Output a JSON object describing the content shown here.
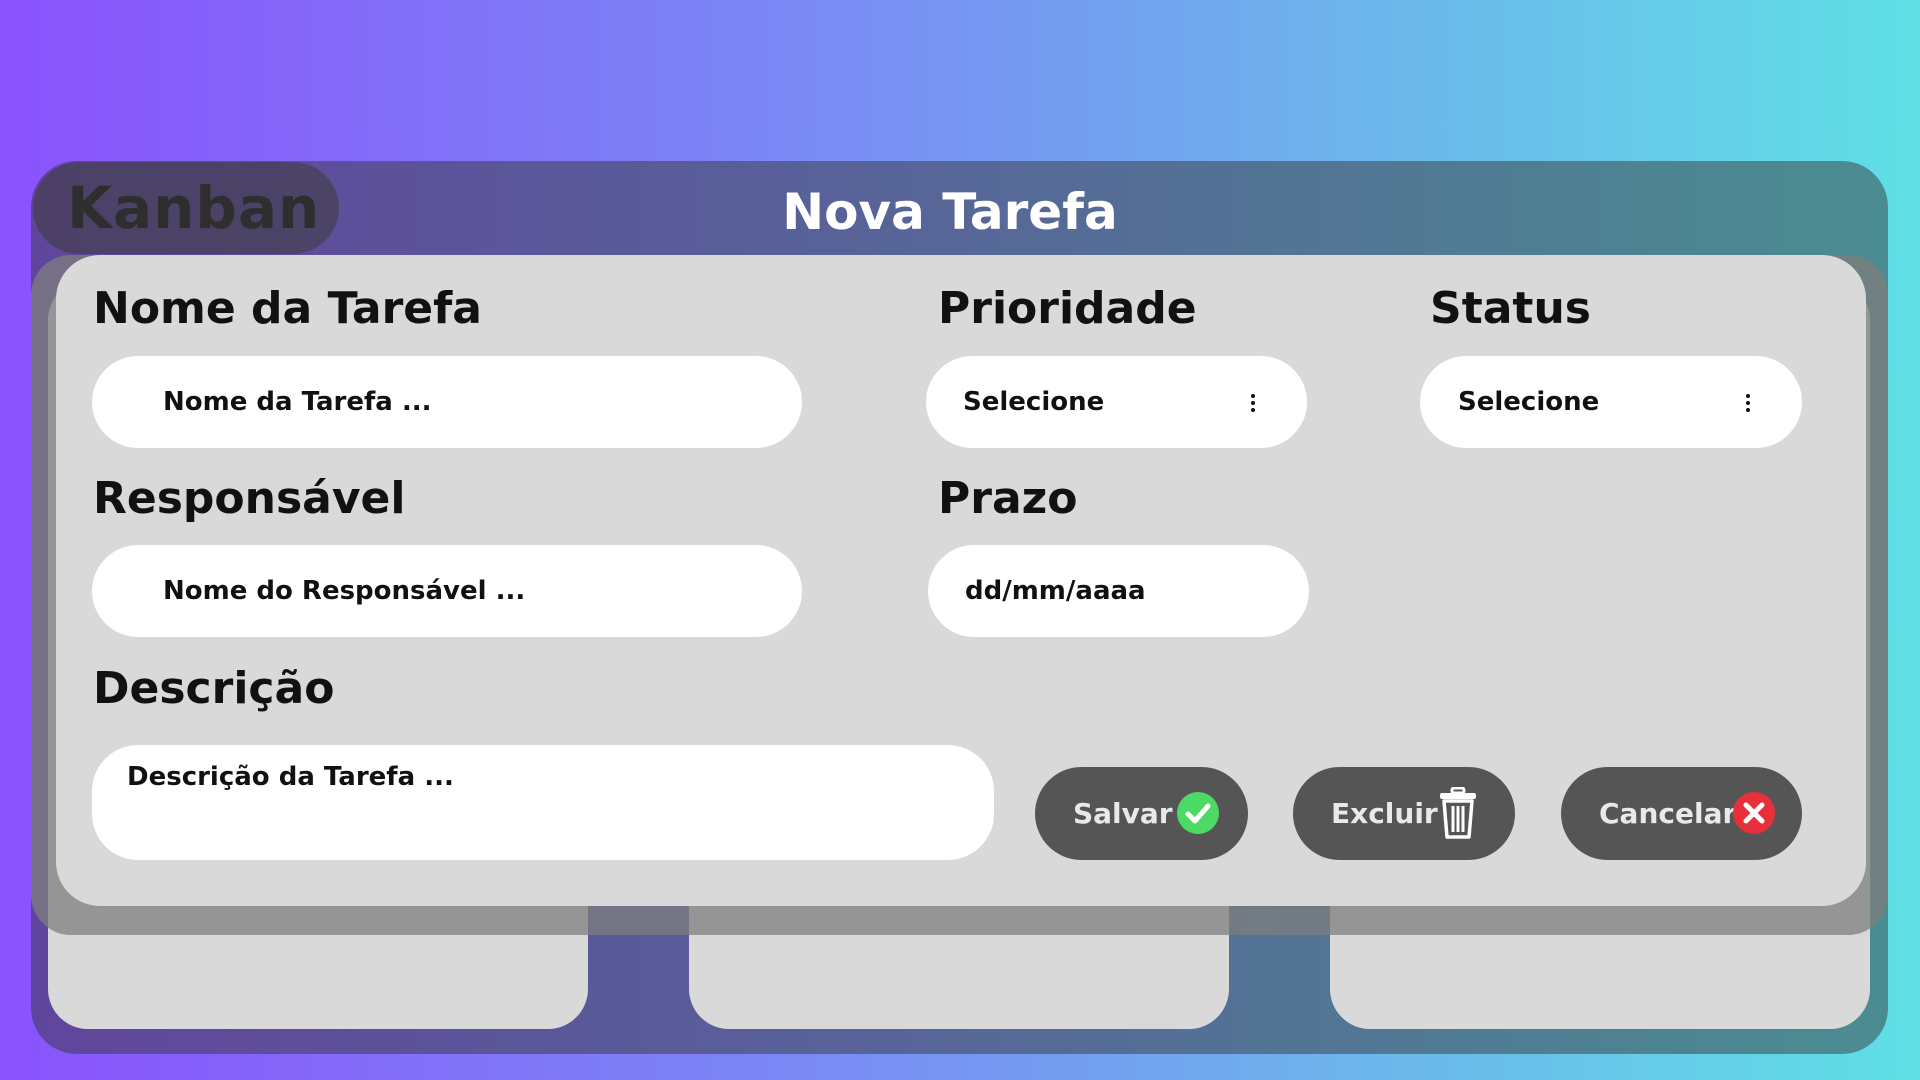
{
  "app": {
    "title": "Kanban"
  },
  "modal": {
    "title": "Nova Tarefa",
    "fields": {
      "task_name": {
        "label": "Nome da Tarefa",
        "placeholder": "Nome da Tarefa  ..."
      },
      "priority": {
        "label": "Prioridade",
        "value": "Selecione"
      },
      "status": {
        "label": "Status",
        "value": "Selecione"
      },
      "assignee": {
        "label": "Responsável",
        "placeholder": "Nome do Responsável ..."
      },
      "deadline": {
        "label": "Prazo",
        "placeholder": "dd/mm/aaaa"
      },
      "description": {
        "label": "Descrição",
        "placeholder": "Descrição da Tarefa  ..."
      }
    },
    "buttons": {
      "save": {
        "label": "Salvar",
        "icon": "check-circle-icon",
        "icon_color": "#4cd964"
      },
      "delete": {
        "label": "Excluir",
        "icon": "trash-icon",
        "icon_color": "#ffffff"
      },
      "cancel": {
        "label": "Cancelar",
        "icon": "x-circle-icon",
        "icon_color": "#e8303a"
      }
    }
  }
}
